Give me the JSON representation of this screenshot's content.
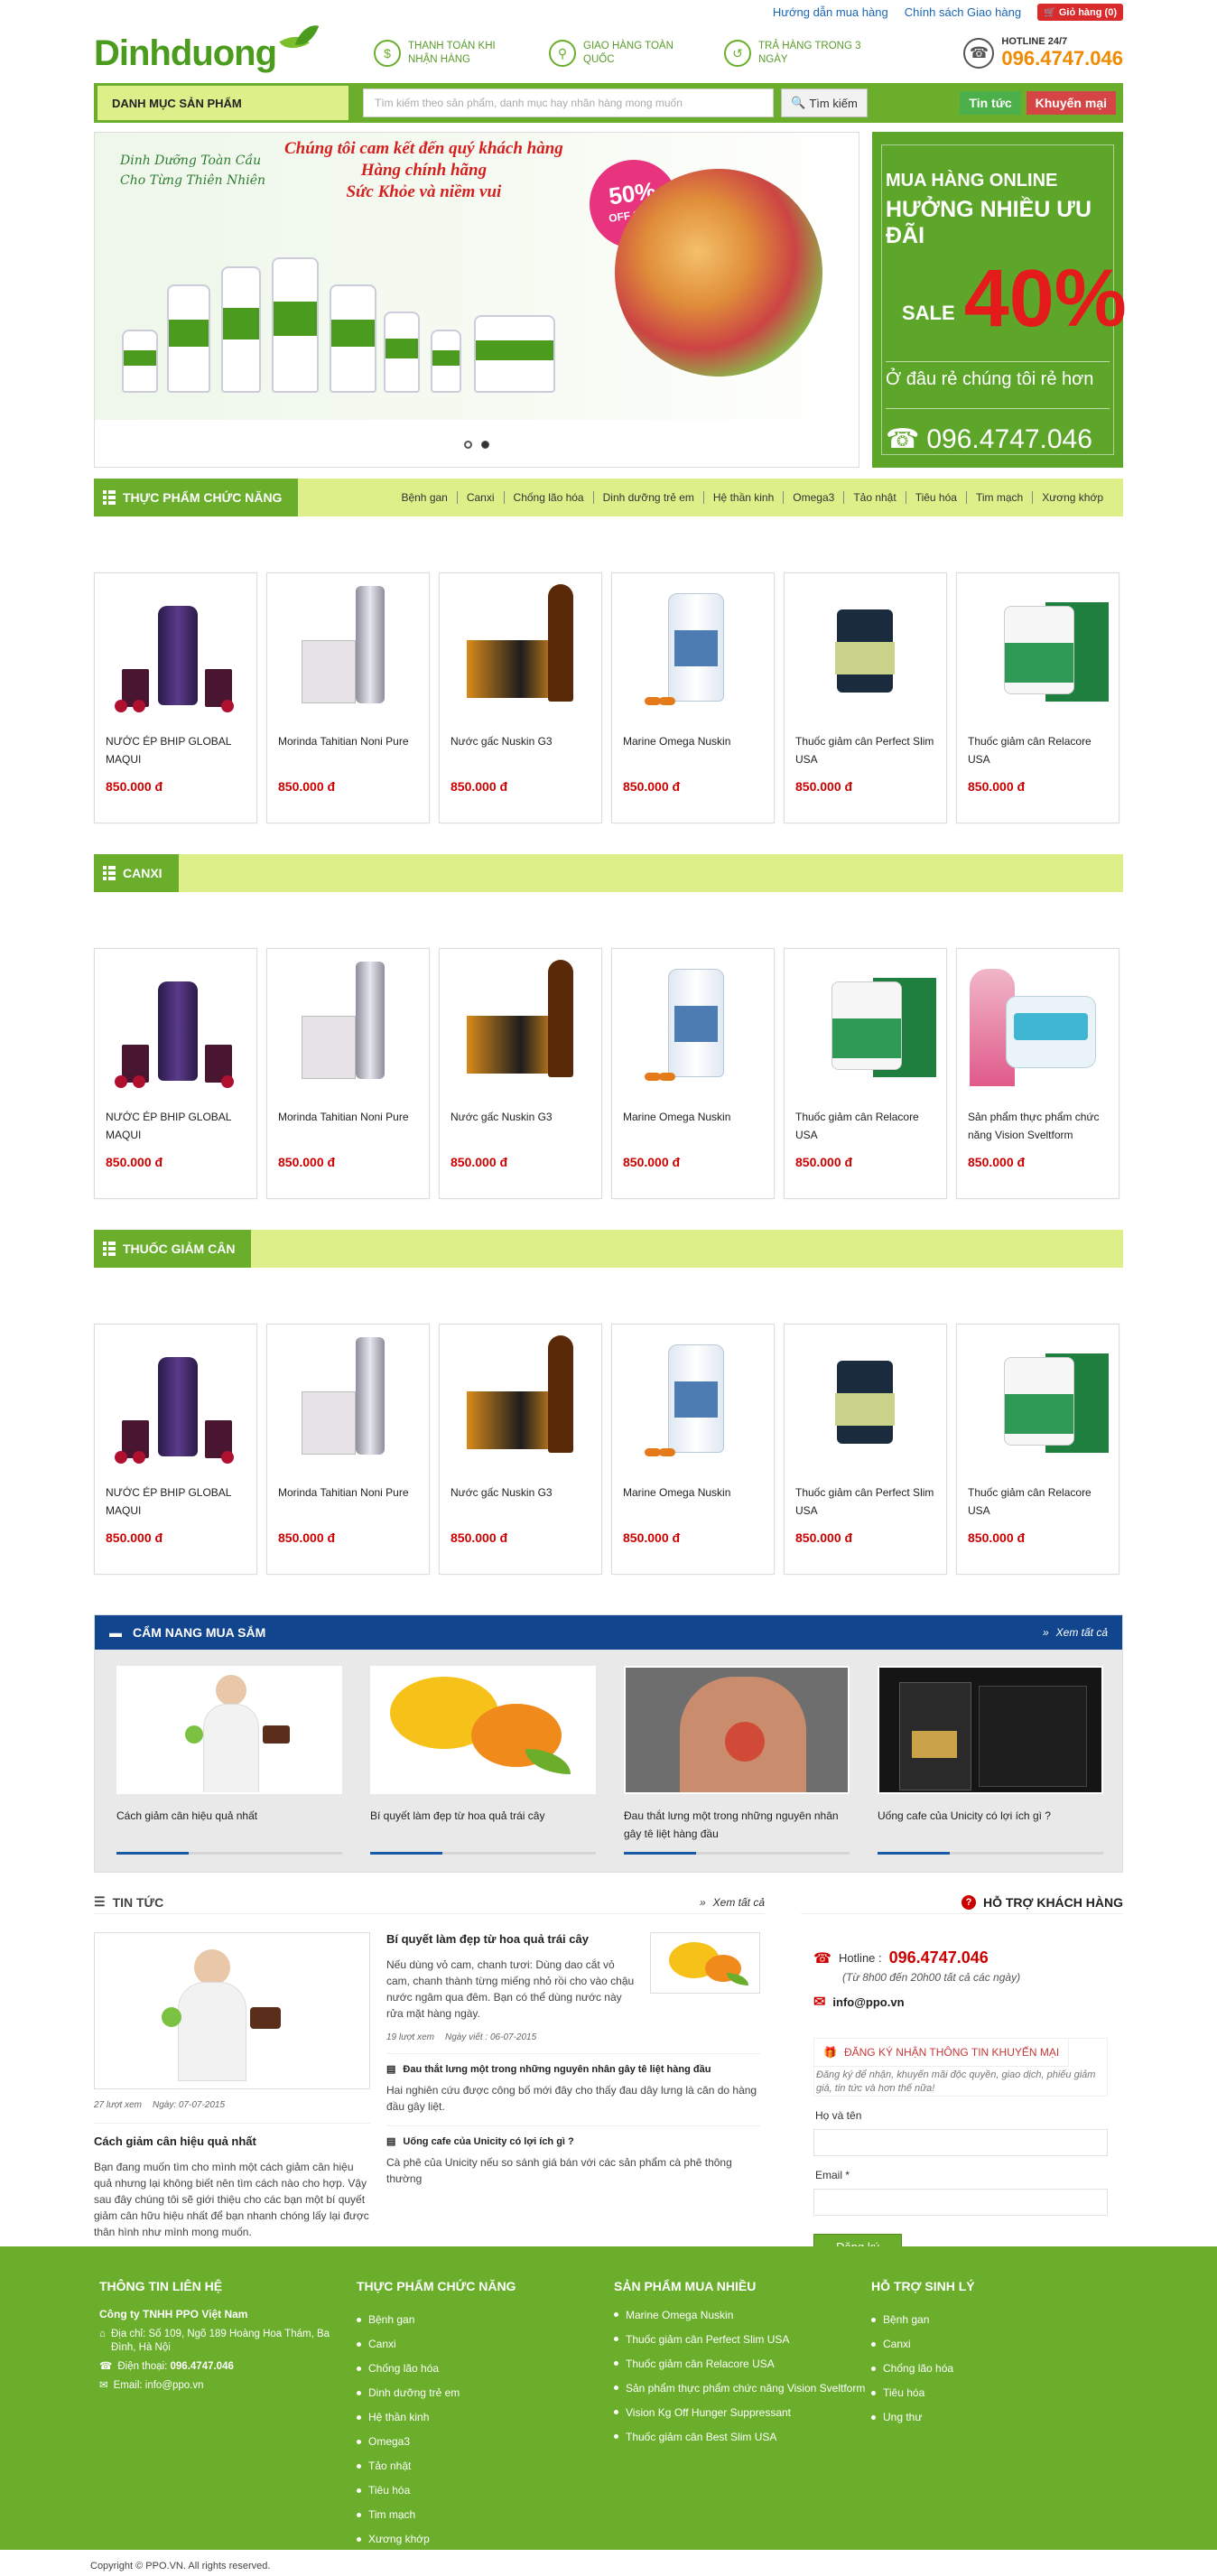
{
  "top_links": {
    "guide": "Hướng dẫn mua hàng",
    "shipping": "Chính sách Giao hàng",
    "cart": "Giỏ hàng (0)"
  },
  "logo": "Dinhduong",
  "features": [
    {
      "icon": "payment-icon",
      "text": "THANH TOÁN KHI NHẬN HÀNG"
    },
    {
      "icon": "delivery-icon",
      "text": "GIAO HÀNG TOÀN QUỐC"
    },
    {
      "icon": "return-icon",
      "text": "TRẢ HÀNG TRONG 3 NGÀY"
    }
  ],
  "hotline": {
    "label": "HOTLINE 24/7",
    "number": "096.4747.046"
  },
  "nav": {
    "category_menu": "DANH MỤC SẢN PHẨM",
    "search_placeholder": "Tìm kiếm theo sản phẩm, danh mục hay nhãn hàng mong muốn",
    "search_button": "Tìm kiếm",
    "news": "Tin tức",
    "promo": "Khuyến mại"
  },
  "slider": {
    "brand_line1": "Dinh Dưỡng Toàn Cầu",
    "brand_line2": "Cho Từng Thiên Nhiên",
    "headline1": "Chúng tôi cam kết đến quý khách hàng",
    "headline2": "Hàng chính hãng",
    "headline3": "Sức Khỏe và niềm vui",
    "badge_pct": "50%",
    "badge_text": "OFF SALE"
  },
  "promo": {
    "online": "MUA HÀNG ONLINE",
    "benefits": "HƯỞNG NHIỀU ƯU ĐÃI",
    "sale": "SALE",
    "percent": "40%",
    "cheap": "Ở đâu rẻ chúng tôi rẻ hơn",
    "phone": "096.4747.046"
  },
  "sections": [
    {
      "title": "THỰC PHẨM CHỨC NĂNG",
      "links": [
        "Bệnh gan",
        "Canxi",
        "Chống lão hóa",
        "Dinh dưỡng trẻ em",
        "Hệ thần kinh",
        "Omega3",
        "Tảo nhật",
        "Tiêu hóa",
        "Tim mạch",
        "Xương khớp"
      ],
      "products": [
        {
          "kind": "juice",
          "name": "NƯỚC ÉP BHIP GLOBAL MAQUI",
          "price": "850.000 đ"
        },
        {
          "kind": "noni",
          "name": "Morinda Tahitian Noni Pure",
          "price": "850.000 đ"
        },
        {
          "kind": "g3",
          "name": "Nước gấc Nuskin G3",
          "price": "850.000 đ"
        },
        {
          "kind": "omega",
          "name": "Marine Omega Nuskin",
          "price": "850.000 đ"
        },
        {
          "kind": "perfect",
          "name": "Thuốc giảm cân Perfect Slim USA",
          "price": "850.000 đ"
        },
        {
          "kind": "relacore",
          "name": "Thuốc giảm cân Relacore USA",
          "price": "850.000 đ"
        }
      ]
    },
    {
      "title": "CANXI",
      "links": [],
      "products": [
        {
          "kind": "juice",
          "name": "NƯỚC ÉP BHIP GLOBAL MAQUI",
          "price": "850.000 đ"
        },
        {
          "kind": "noni",
          "name": "Morinda Tahitian Noni Pure",
          "price": "850.000 đ"
        },
        {
          "kind": "g3",
          "name": "Nước gấc Nuskin G3",
          "price": "850.000 đ"
        },
        {
          "kind": "omega",
          "name": "Marine Omega Nuskin",
          "price": "850.000 đ"
        },
        {
          "kind": "relacore",
          "name": "Thuốc giảm cân Relacore USA",
          "price": "850.000 đ"
        },
        {
          "kind": "vision",
          "name": "Sản phẩm thực phẩm chức năng Vision Sveltform",
          "price": "850.000 đ"
        }
      ]
    },
    {
      "title": "THUỐC GIẢM CÂN",
      "links": [],
      "products": [
        {
          "kind": "juice",
          "name": "NƯỚC ÉP BHIP GLOBAL MAQUI",
          "price": "850.000 đ"
        },
        {
          "kind": "noni",
          "name": "Morinda Tahitian Noni Pure",
          "price": "850.000 đ"
        },
        {
          "kind": "g3",
          "name": "Nước gấc Nuskin G3",
          "price": "850.000 đ"
        },
        {
          "kind": "omega",
          "name": "Marine Omega Nuskin",
          "price": "850.000 đ"
        },
        {
          "kind": "perfect",
          "name": "Thuốc giảm cân Perfect Slim USA",
          "price": "850.000 đ"
        },
        {
          "kind": "relacore",
          "name": "Thuốc giảm cân Relacore USA",
          "price": "850.000 đ"
        }
      ]
    }
  ],
  "guide": {
    "title": "CẨM NANG MUA SẮM",
    "more": "Xem tất cả",
    "items": [
      {
        "kind": "woman",
        "caption": "Cách giảm cân hiệu quả nhất"
      },
      {
        "kind": "orange",
        "caption": "Bí quyết làm đẹp từ hoa quả trái cây"
      },
      {
        "kind": "back",
        "caption": "Đau thắt lưng một trong những nguyên nhân gây tê liệt hàng đầu"
      },
      {
        "kind": "coffee",
        "caption": "Uống cafe của Unicity có lợi ích gì ?"
      }
    ]
  },
  "news": {
    "title": "TIN TỨC",
    "more": "Xem tất cả",
    "main": {
      "views": "27 lượt xem",
      "date": "Ngày: 07-07-2015",
      "title": "Cách giảm cân hiệu quả nhất",
      "desc": "Bạn đang muốn tìm cho mình một cách giảm cân hiệu quả nhưng lại không biết nên tìm cách nào cho hợp. Vậy sau đây chúng tôi sẽ giới thiệu cho các bạn một bí quyết giảm cân hữu hiệu nhất để bạn nhanh chóng lấy lại được thân hình như mình mong muốn."
    },
    "top": {
      "title": "Bí quyết làm đẹp từ hoa quả trái cây",
      "desc": "Nếu dùng vỏ cam, chanh tươi: Dùng dao cắt vỏ cam, chanh thành từng miếng nhỏ rồi cho vào chậu nước ngâm qua đêm. Bạn có thể dùng nước này rửa mặt hàng ngày.",
      "views": "19 lượt xem",
      "date": "Ngày viết : 06-07-2015"
    },
    "items": [
      {
        "title": "Đau thắt lưng một trong những nguyên nhân gây tê liệt hàng đầu",
        "desc": "Hai nghiên cứu được công bố mới đây cho thấy đau dây lưng là căn do hàng đầu gây liệt."
      },
      {
        "title": "Uống cafe của Unicity có lợi ích gì ?",
        "desc": "Cà phê của Unicity nếu so sánh giá bán với các sản phẩm cà phê thông thường"
      }
    ]
  },
  "support": {
    "title": "HỖ TRỢ KHÁCH HÀNG",
    "hotline_label": "Hotline :",
    "hotline": "096.4747.046",
    "hours": "(Từ 8h00 đến 20h00 tất cả các ngày)",
    "email": "info@ppo.vn",
    "subscribe_title": "ĐĂNG KÝ NHẬN THÔNG TIN KHUYẾN MẠI",
    "subscribe_desc": "Đăng ký để nhận, khuyến mãi độc quyền, giao dịch, phiếu giảm giá, tin tức và hơn thế nữa!",
    "name_label": "Họ và tên",
    "email_label": "Email *",
    "button": "Đăng ký"
  },
  "footer": {
    "contact": {
      "title": "THÔNG TIN LIÊN HỆ",
      "company": "Công ty TNHH PPO Việt Nam",
      "address": "Địa chỉ: Số 109, Ngõ 189 Hoàng Hoa Thám, Ba Đình, Hà Nội",
      "phone_label": "Điện thoại: ",
      "phone": "096.4747.046",
      "email": "Email: info@ppo.vn"
    },
    "functional": {
      "title": "THỰC PHẨM CHỨC NĂNG",
      "items": [
        "Bệnh gan",
        "Canxi",
        "Chống lão hóa",
        "Dinh dưỡng trẻ em",
        "Hệ thần kinh",
        "Omega3",
        "Tảo nhật",
        "Tiêu hóa",
        "Tim mạch",
        "Xương khớp"
      ]
    },
    "bestsellers": {
      "title": "SẢN PHẨM MUA NHIỀU",
      "items": [
        "Marine Omega Nuskin",
        "Thuốc giảm cân Perfect Slim USA",
        "Thuốc giảm cân Relacore USA",
        "Sản phẩm thực phẩm chức năng Vision Sveltform",
        "Vision Kg Off Hunger Suppressant",
        "Thuốc giảm cân Best Slim USA"
      ]
    },
    "physio": {
      "title": "HỖ TRỢ SINH LÝ",
      "items": [
        "Bệnh gan",
        "Canxi",
        "Chống lão hóa",
        "Tiêu hóa",
        "Ung thư"
      ]
    }
  },
  "copyright": "Copyright © PPO.VN. All rights reserved."
}
